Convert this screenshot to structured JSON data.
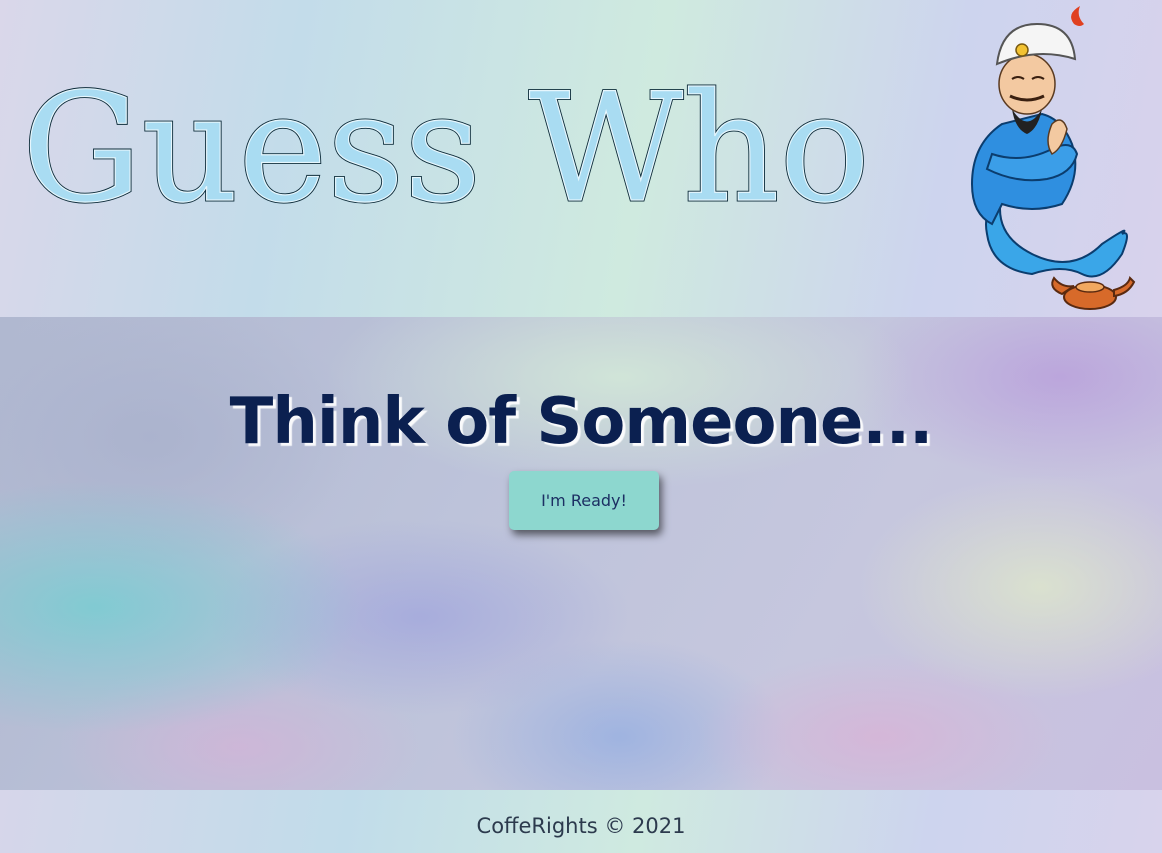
{
  "header": {
    "logo_text": "Guess Who",
    "mascot_icon": "genie-mascot-icon"
  },
  "main": {
    "headline": "Think of Someone...",
    "ready_button_label": "I'm Ready!"
  },
  "footer": {
    "copyright": "CoffeRights © 2021"
  },
  "colors": {
    "headline": "#0b2050",
    "button_bg": "#8dd7cf",
    "button_text": "#1c2f63",
    "logo_fill": "#a9dcf2"
  }
}
